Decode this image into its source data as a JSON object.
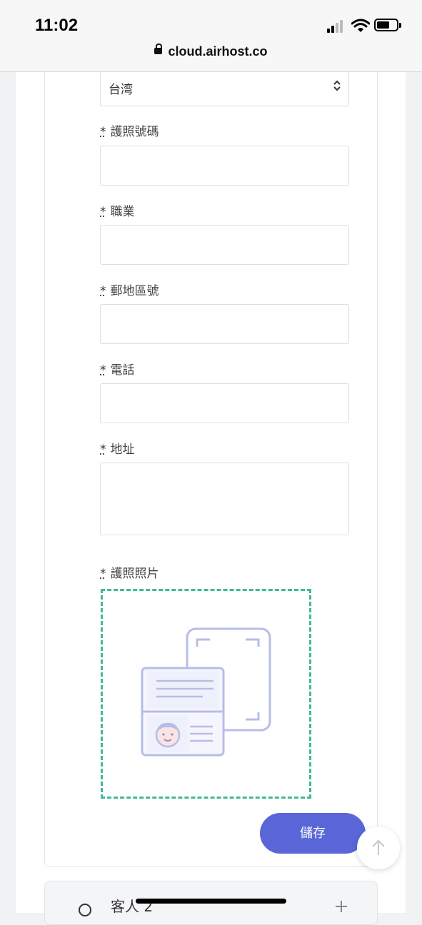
{
  "status_bar": {
    "time": "11:02",
    "url": "cloud.airhost.co"
  },
  "form": {
    "nationality": {
      "value": "台湾"
    },
    "required_mark": "*",
    "fields": [
      {
        "label": "護照號碼",
        "value": ""
      },
      {
        "label": "職業",
        "value": ""
      },
      {
        "label": "郵地區號",
        "value": ""
      },
      {
        "label": "電話",
        "value": ""
      },
      {
        "label": "地址",
        "value": ""
      }
    ],
    "passport_photo": {
      "label": "護照照片"
    },
    "save_label": "儲存"
  },
  "guest2": {
    "label": "客人 2"
  },
  "colors": {
    "accent": "#5a66d8",
    "upload_border": "#3fb99a",
    "illustration": "#b7bde8"
  }
}
